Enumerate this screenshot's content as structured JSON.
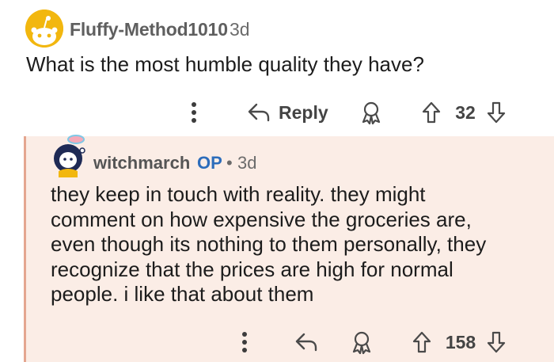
{
  "parent_comment": {
    "username": "Fluffy-Method1010",
    "time": "3d",
    "text": "What is the most humble quality they have?",
    "actions": {
      "reply_label": "Reply",
      "score": "32"
    }
  },
  "reply_comment": {
    "username": "witchmarch",
    "op_badge": "OP",
    "separator": "•",
    "time": "3d",
    "text_lines": [
      "they keep in touch with reality. they might",
      "comment on how expensive the groceries are,",
      "even though its nothing to them personally, they",
      "recognize that the prices are high for normal",
      "people. i like that about them"
    ],
    "actions": {
      "score": "158"
    }
  },
  "colors": {
    "reply_background": "#fbede6",
    "thread_line": "#e4a690",
    "op_badge": "#2d6dbb",
    "avatar_parent": "#f2b70f"
  }
}
